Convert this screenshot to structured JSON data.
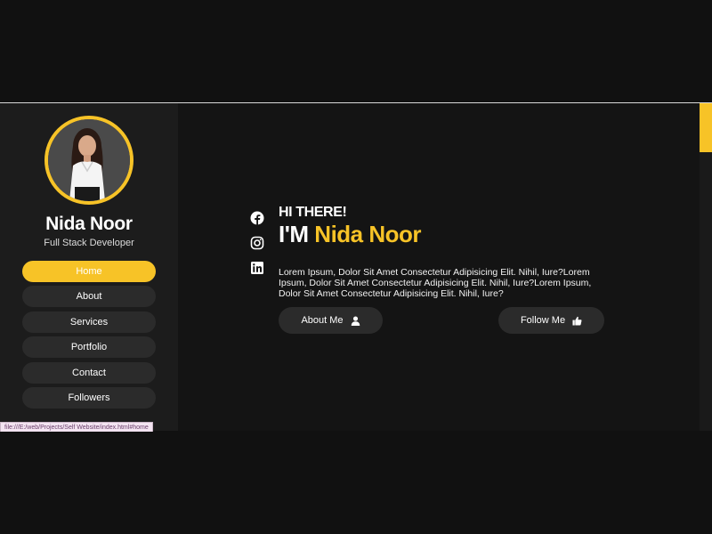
{
  "profile": {
    "name": "Nida Noor",
    "role": "Full Stack Developer"
  },
  "nav": {
    "items": [
      {
        "label": "Home",
        "active": true
      },
      {
        "label": "About",
        "active": false
      },
      {
        "label": "Services",
        "active": false
      },
      {
        "label": "Portfolio",
        "active": false
      },
      {
        "label": "Contact",
        "active": false
      },
      {
        "label": "Followers",
        "active": false
      }
    ]
  },
  "social": {
    "icons": [
      "facebook-icon",
      "instagram-icon",
      "linkedin-icon"
    ]
  },
  "hero": {
    "greeting": "HI THERE!",
    "title_prefix": "I'M ",
    "title_name": "Nida Noor",
    "text": "Lorem Ipsum, Dolor Sit Amet Consectetur Adipisicing Elit. Nihil, Iure?Lorem Ipsum, Dolor Sit Amet Consectetur Adipisicing Elit. Nihil, Iure?Lorem Ipsum, Dolor Sit Amet Consectetur Adipisicing Elit. Nihil, Iure?"
  },
  "buttons": {
    "about_label": "About Me",
    "follow_label": "Follow Me"
  },
  "status_bar": {
    "url": "file:///E:/web/Projects/Self Website/index.html#home"
  },
  "colors": {
    "accent": "#f7c327",
    "background": "#141414",
    "sidebar": "#1c1c1c",
    "button": "#2b2b2b"
  },
  "scrollbar": {
    "position": 0
  }
}
